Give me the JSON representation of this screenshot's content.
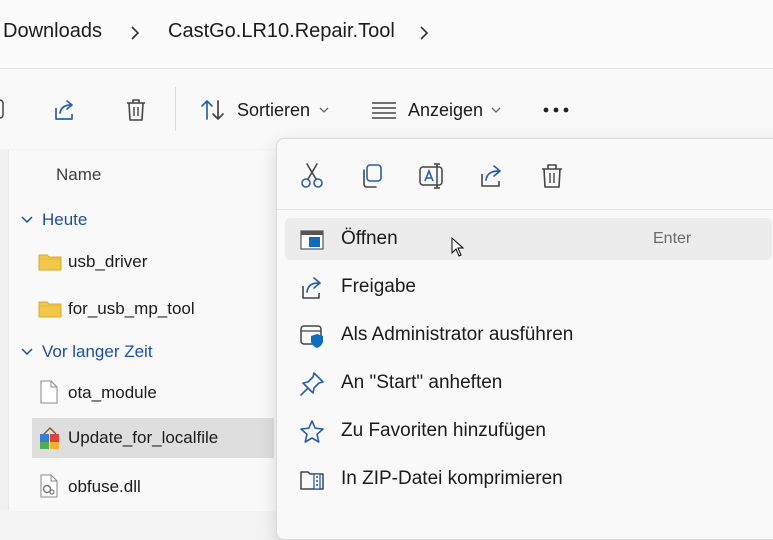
{
  "breadcrumb": {
    "items": [
      "Downloads",
      "CastGo.LR10.Repair.Tool"
    ]
  },
  "toolbar": {
    "sort_label": "Sortieren",
    "view_label": "Anzeigen",
    "icons": [
      "share-icon",
      "trash-icon",
      "sort-icon",
      "view-icon",
      "more-icon"
    ]
  },
  "file_list": {
    "column_header": "Name",
    "groups": [
      {
        "label": "Heute",
        "items": [
          {
            "name": "usb_driver",
            "icon": "folder-icon"
          },
          {
            "name": "for_usb_mp_tool",
            "icon": "folder-icon"
          }
        ]
      },
      {
        "label": "Vor langer Zeit",
        "items": [
          {
            "name": "ota_module",
            "icon": "file-icon"
          },
          {
            "name": "Update_for_localfile",
            "icon": "installer-icon",
            "selected": true
          },
          {
            "name": "obfuse.dll",
            "icon": "dll-icon"
          }
        ]
      }
    ]
  },
  "context_menu": {
    "quick_actions": [
      "cut-icon",
      "copy-icon",
      "rename-icon",
      "share-icon",
      "delete-icon"
    ],
    "items": [
      {
        "label": "Öffnen",
        "shortcut": "Enter",
        "icon": "open-icon"
      },
      {
        "label": "Freigabe",
        "icon": "share-icon"
      },
      {
        "label": "Als Administrator ausführen",
        "icon": "shield-icon"
      },
      {
        "label": "An \"Start\" anheften",
        "icon": "pin-icon"
      },
      {
        "label": "Zu Favoriten hinzufügen",
        "icon": "star-icon"
      },
      {
        "label": "In ZIP-Datei komprimieren",
        "icon": "zip-icon"
      }
    ]
  },
  "colors": {
    "accent": "#0f6cbd",
    "group_header": "#1f4f9a",
    "folder": "#f3c84a"
  }
}
